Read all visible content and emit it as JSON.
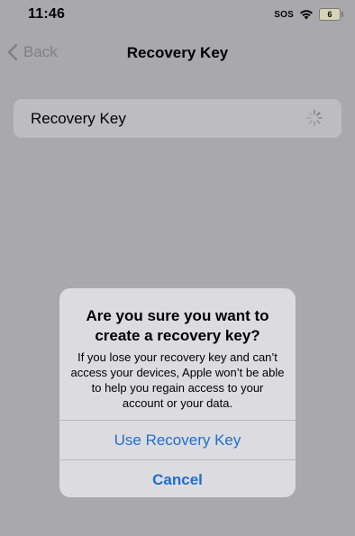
{
  "status_bar": {
    "time": "11:46",
    "sos": "SOS",
    "battery_level": "6"
  },
  "nav": {
    "back_label": "Back",
    "title": "Recovery Key"
  },
  "settings": {
    "row_label": "Recovery Key"
  },
  "alert": {
    "title": "Are you sure you want to create a recovery key?",
    "message": "If you lose your recovery key and can’t access your devices, Apple won’t be able to help you regain access to your account or your data.",
    "primary_button": "Use Recovery Key",
    "cancel_button": "Cancel"
  },
  "colors": {
    "accent": "#1f6fd0",
    "background_dimmed": "#a9a8ad",
    "alert_background": "#dcdbe0"
  },
  "icons": {
    "back": "chevron-left-icon",
    "wifi": "wifi-icon",
    "battery": "battery-icon",
    "loading": "spinner-icon"
  }
}
